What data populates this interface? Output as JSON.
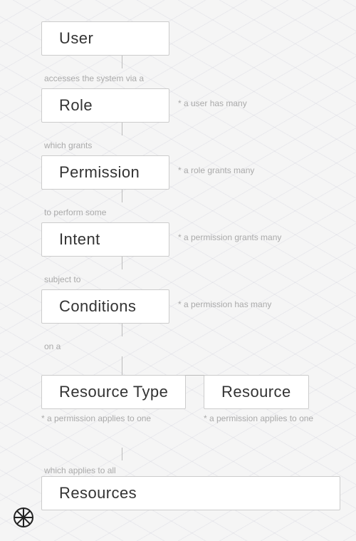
{
  "nodes": {
    "user": {
      "label": "User"
    },
    "role": {
      "label": "Role"
    },
    "permission": {
      "label": "Permission"
    },
    "intent": {
      "label": "Intent"
    },
    "conditions": {
      "label": "Conditions"
    },
    "resourceType": {
      "label": "Resource Type"
    },
    "resource": {
      "label": "Resource"
    },
    "resources": {
      "label": "Resources"
    }
  },
  "connectors": {
    "userToRole": "accesses the system via a",
    "roleNote": "* a user has many",
    "roleToPermission": "which grants",
    "permissionNote": "* a role grants many",
    "permissionToIntent": "to perform some",
    "intentNote": "* a permission grants many",
    "intentToConditions": "subject to",
    "conditionsNote": "* a permission has many",
    "conditionsToResource": "on a",
    "resourceTypeNote": "* a permission applies to one",
    "resourceNote": "* a permission applies to one",
    "resourceTypeToResources": "which applies to all",
    "resourcesLabel": "Resources"
  },
  "logo": {
    "symbol": "⊗"
  }
}
